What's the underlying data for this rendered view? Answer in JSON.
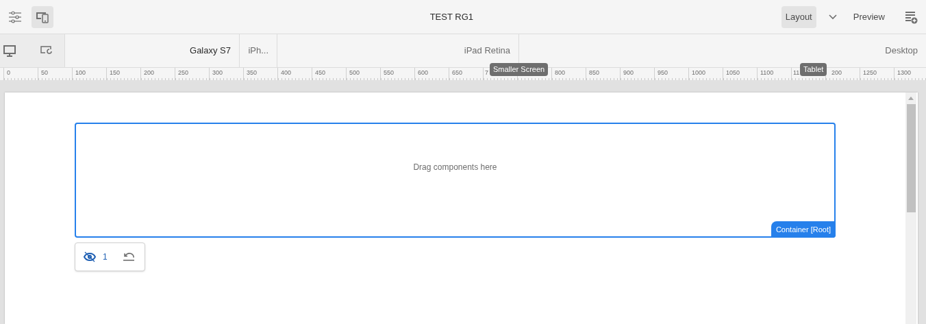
{
  "header": {
    "title": "TEST RG1",
    "mode_buttons": [
      {
        "label": "Layout",
        "selected": true
      },
      {
        "label": "Preview",
        "selected": false
      }
    ],
    "side_panel_selected": false,
    "emulator_selected": true
  },
  "device_bar": {
    "segments": [
      "Galaxy S7",
      "iPh...",
      "iPad Retina",
      "Desktop"
    ]
  },
  "ruler": {
    "labels": [
      "0",
      "50",
      "100",
      "150",
      "200",
      "250",
      "300",
      "350",
      "400",
      "450",
      "500",
      "550",
      "600",
      "650",
      "7",
      "800",
      "850",
      "900",
      "950",
      "1000",
      "1050",
      "1100",
      "11",
      "200",
      "1250",
      "1300"
    ]
  },
  "tooltips": [
    "Smaller Screen",
    "Tablet"
  ],
  "canvas": {
    "placeholder": "Drag components here",
    "container_label": "Container [Root]",
    "hidden_count": "1"
  }
}
